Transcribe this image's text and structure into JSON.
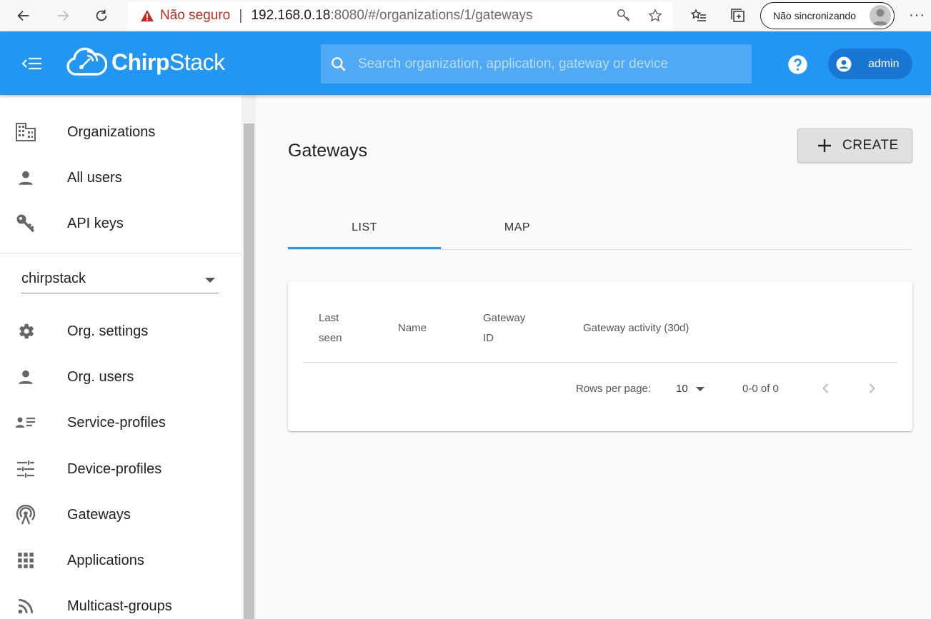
{
  "browser": {
    "security_label": "Não seguro",
    "url_host": "192.168.0.18",
    "url_rest": ":8080/#/organizations/1/gateways",
    "profile_label": "Não sincronizando"
  },
  "appbar": {
    "logo_bold": "Chirp",
    "logo_light": "Stack",
    "search_placeholder": "Search organization, application, gateway or device",
    "user_label": "admin"
  },
  "sidebar": {
    "admin_items": [
      {
        "label": "Organizations",
        "icon": "building-icon"
      },
      {
        "label": "All users",
        "icon": "person-icon"
      },
      {
        "label": "API keys",
        "icon": "key-icon"
      }
    ],
    "org_select_value": "chirpstack",
    "org_items": [
      {
        "label": "Org. settings",
        "icon": "gear-icon"
      },
      {
        "label": "Org. users",
        "icon": "person-icon"
      },
      {
        "label": "Service-profiles",
        "icon": "profile-list-icon"
      },
      {
        "label": "Device-profiles",
        "icon": "tune-icon"
      },
      {
        "label": "Gateways",
        "icon": "gateway-icon"
      },
      {
        "label": "Applications",
        "icon": "apps-grid-icon"
      },
      {
        "label": "Multicast-groups",
        "icon": "rss-icon"
      }
    ]
  },
  "main": {
    "title": "Gateways",
    "create_label": "CREATE",
    "tabs": [
      {
        "label": "LIST",
        "active": true
      },
      {
        "label": "MAP",
        "active": false
      }
    ],
    "table": {
      "headers": [
        "Last seen",
        "Name",
        "Gateway ID",
        "Gateway activity (30d)"
      ],
      "rows_per_page_label": "Rows per page:",
      "rows_per_page_value": "10",
      "range_label": "0-0 of 0"
    }
  },
  "colors": {
    "appbar": "#2196f3",
    "accent": "#2196f3",
    "warning": "#c42b1c"
  }
}
